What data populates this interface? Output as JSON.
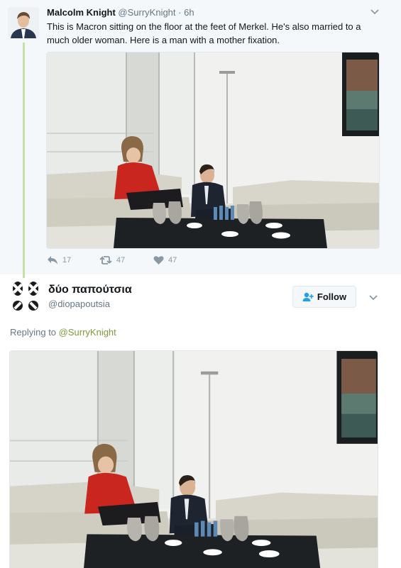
{
  "parent_tweet": {
    "author_name": "Malcolm Knight",
    "handle": "@SurryKnight",
    "separator": "·",
    "time": "6h",
    "text": "This is Macron sitting on the floor at the feet of Merkel. He's also married to a much older woman. Here is a man with a mother fixation.",
    "avatar": "user-avatar-photo",
    "actions": {
      "reply_count": "17",
      "retweet_count": "47",
      "like_count": "47"
    },
    "icons": [
      "reply-icon",
      "retweet-icon",
      "heart-icon",
      "chevron-down-icon"
    ]
  },
  "reply_tweet": {
    "author_name": "δύο παπούτσια",
    "handle": "@diopapoutsia",
    "avatar": "footprints-avatar",
    "follow_label": "Follow",
    "replying_prefix": "Replying to ",
    "replying_handle": "@SurryKnight"
  },
  "colors": {
    "accent_green": "#7f9a3a",
    "thread_line": "#c5e1a5",
    "muted_text": "#657786",
    "action_icons": "#8899a6",
    "parent_background": "#f5f8fa"
  }
}
